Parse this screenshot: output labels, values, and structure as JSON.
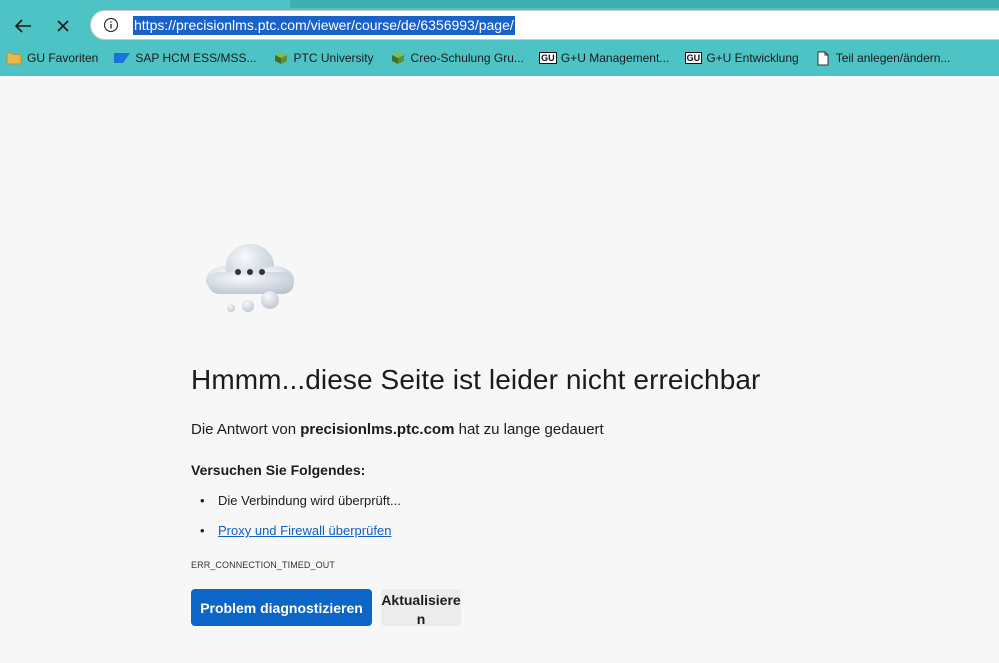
{
  "browser": {
    "url": "https://precisionlms.ptc.com/viewer/course/de/6356993/page/",
    "bookmarks": [
      {
        "label": "GU Favoriten",
        "icon": "folder-icon"
      },
      {
        "label": "SAP HCM ESS/MSS...",
        "icon": "sap-logo-icon"
      },
      {
        "label": "PTC University",
        "icon": "ptc-cube-icon"
      },
      {
        "label": "Creo-Schulung Gru...",
        "icon": "ptc-cube-icon"
      },
      {
        "label": "G+U Management...",
        "icon": "gu-logo-icon",
        "logo_text": "GU"
      },
      {
        "label": "G+U Entwicklung",
        "icon": "gu-logo-icon",
        "logo_text": "GU"
      },
      {
        "label": "Teil anlegen/ändern...",
        "icon": "document-icon"
      }
    ],
    "colors": {
      "chrome": "#4ec3c5",
      "url_highlight": "#1a62c9"
    }
  },
  "error_page": {
    "headline": "Hmmm...diese Seite ist leider nicht erreichbar",
    "subline_prefix": "Die Antwort von ",
    "domain": "precisionlms.ptc.com",
    "subline_suffix": " hat zu lange gedauert",
    "try_title": "Versuchen Sie Folgendes:",
    "tips": [
      "Die Verbindung wird überprüft...",
      "Proxy und Firewall überprüfen"
    ],
    "error_code": "ERR_CONNECTION_TIMED_OUT",
    "diagnose_button": "Problem diagnostizieren",
    "reload_button": "Aktualisieren",
    "colors": {
      "primary_button": "#0c66c8",
      "link": "#0f5fc8"
    }
  }
}
